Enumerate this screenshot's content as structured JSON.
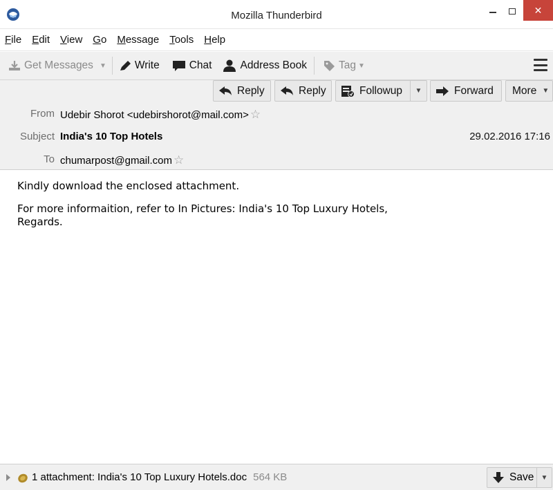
{
  "window": {
    "title": "Mozilla Thunderbird",
    "close_glyph": "✕"
  },
  "menu": {
    "items": [
      "File",
      "Edit",
      "View",
      "Go",
      "Message",
      "Tools",
      "Help"
    ]
  },
  "toolbar": {
    "get_messages": "Get Messages",
    "write": "Write",
    "chat": "Chat",
    "address_book": "Address Book",
    "tag": "Tag"
  },
  "header_actions": {
    "reply_all": "Reply",
    "reply": "Reply",
    "followup": "Followup",
    "forward": "Forward",
    "more": "More"
  },
  "headers": {
    "from_label": "From",
    "from_value": "Udebir Shorot <udebirshorot@mail.com>",
    "subject_label": "Subject",
    "subject_value": "India's 10 Top Hotels",
    "date_value": "29.02.2016 17:16",
    "to_label": "To",
    "to_value": "chumarpost@gmail.com",
    "star_glyph": "☆"
  },
  "body": {
    "line1": "Kindly download the enclosed attachment.",
    "line2": "For more informaition, refer to In Pictures: India's 10 Top Luxury Hotels,",
    "line3": "Regards."
  },
  "attachment": {
    "summary": "1 attachment: India's 10 Top Luxury Hotels.doc",
    "size": "564 KB",
    "save_label": "Save"
  },
  "colors": {
    "close_button": "#c7443a",
    "toolbar_bg": "#f0f0f0",
    "label_gray": "#6d6d6d"
  },
  "icons": [
    "thunderbird-logo-icon",
    "get-messages-icon",
    "pencil-icon",
    "chat-bubble-icon",
    "address-book-icon",
    "tag-icon",
    "hamburger-menu-icon",
    "reply-all-icon",
    "reply-icon",
    "followup-icon",
    "forward-icon",
    "star-icon",
    "paperclip-icon",
    "save-download-icon",
    "chevron-down-icon"
  ]
}
